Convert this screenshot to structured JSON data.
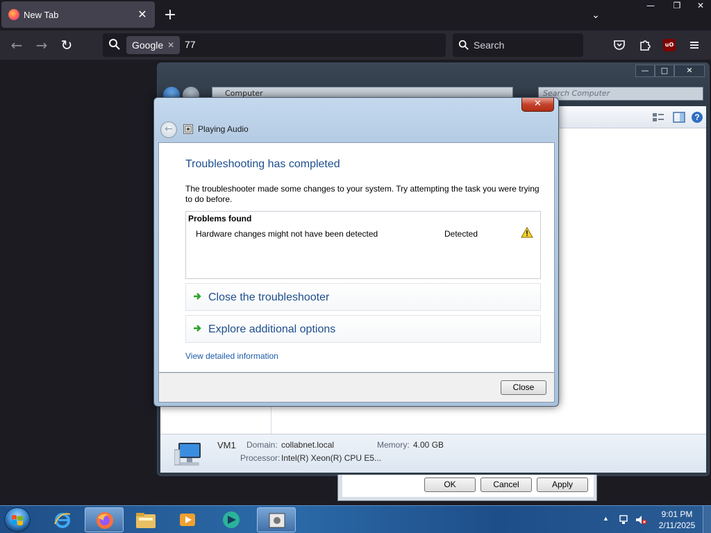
{
  "firefox": {
    "tab_title": "New Tab",
    "tab_close": "✕",
    "new_tab": "+",
    "list_all_tabs": "⌄",
    "window_controls": {
      "minimize": "—",
      "restore": "❐",
      "close": "✕"
    },
    "nav": {
      "back": "←",
      "forward": "→",
      "reload": "↻"
    },
    "urlbar": {
      "engine": "Google",
      "engine_remove": "✕",
      "text": "77"
    },
    "searchbar": {
      "placeholder": "Search"
    },
    "toolbar_icons": [
      "pocket-icon",
      "extensions-icon",
      "ublock-origin-icon",
      "menu-icon"
    ],
    "ublock_label": "uO"
  },
  "explorer": {
    "address_path": "Computer",
    "search_placeholder": "Search Computer",
    "window_controls": {
      "minimize": "—",
      "maximize": "□",
      "close": "✕"
    },
    "details": {
      "computer_name": "VM1",
      "domain_label": "Domain:",
      "domain_value": "collabnet.local",
      "memory_label": "Memory:",
      "memory_value": "4.00 GB",
      "processor_label": "Processor:",
      "processor_value": "Intel(R) Xeon(R) CPU E5..."
    }
  },
  "back_dialog": {
    "ok": "OK",
    "cancel": "Cancel",
    "apply": "Apply"
  },
  "troubleshooter": {
    "close_glyph": "✕",
    "back_glyph": "←",
    "window_title": "Playing Audio",
    "heading": "Troubleshooting has completed",
    "description": "The troubleshooter made some changes to your system. Try attempting the task you were trying to do before.",
    "problems_header": "Problems found",
    "problems": [
      {
        "name": "Hardware changes might not have been detected",
        "status": "Detected",
        "icon": "warning-icon"
      }
    ],
    "options": [
      {
        "label": "Close the troubleshooter"
      },
      {
        "label": "Explore additional options"
      }
    ],
    "detail_link": "View detailed information",
    "close_button": "Close"
  },
  "taskbar": {
    "apps": [
      "internet-explorer-icon",
      "firefox-icon",
      "windows-explorer-icon",
      "media-player-icon",
      "collabnet-app-icon",
      "troubleshooter-icon"
    ],
    "clock_time": "9:01 PM",
    "clock_date": "2/11/2025",
    "tray_arrow": "▲"
  },
  "colors": {
    "firefox_bg": "#1c1b22",
    "heading_blue": "#1e4e8c",
    "link_blue": "#1e5ba8",
    "taskbar_blue": "#2b6aa9"
  }
}
